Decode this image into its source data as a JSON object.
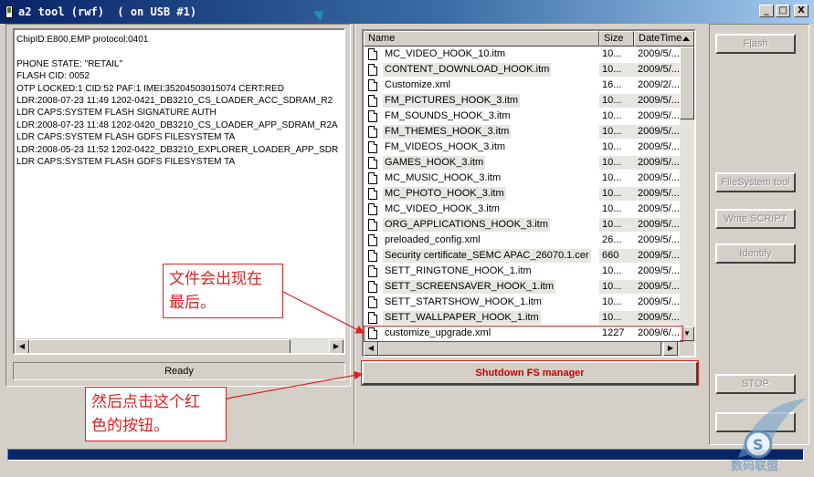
{
  "window": {
    "title": "a2 tool (rwf)  ( on USB #1)",
    "controls": {
      "minimize": "_",
      "maximize": "□",
      "close": "X"
    }
  },
  "log": {
    "lines": [
      "ChipID:E800,EMP protocol:0401",
      "",
      "PHONE STATE: \"RETAIL\"",
      "FLASH CID: 0052",
      "OTP LOCKED:1 CID:52 PAF:1 IMEI:35204503015074 CERT:RED",
      "LDR:2008-07-23 11:49 1202-0421_DB3210_CS_LOADER_ACC_SDRAM_R2",
      "LDR CAPS:SYSTEM FLASH SIGNATURE AUTH",
      "LDR:2008-07-23 11:48 1202-0420_DB3210_CS_LOADER_APP_SDRAM_R2A",
      "LDR CAPS:SYSTEM FLASH GDFS FILESYSTEM TA",
      "LDR:2008-05-23 11:52 1202-0422_DB3210_EXPLORER_LOADER_APP_SDR",
      "LDR CAPS:SYSTEM FLASH GDFS FILESYSTEM TA"
    ],
    "status": "Ready"
  },
  "file_list": {
    "columns": {
      "name": "Name",
      "size": "Size",
      "date": "DateTime"
    },
    "rows": [
      {
        "name": "MC_VIDEO_HOOK_10.itm",
        "size": "10...",
        "date": "2009/5/..."
      },
      {
        "name": "CONTENT_DOWNLOAD_HOOK.itm",
        "size": "10...",
        "date": "2009/5/..."
      },
      {
        "name": "Customize.xml",
        "size": "16...",
        "date": "2009/2/..."
      },
      {
        "name": "FM_PICTURES_HOOK_3.itm",
        "size": "10...",
        "date": "2009/5/..."
      },
      {
        "name": "FM_SOUNDS_HOOK_3.itm",
        "size": "10...",
        "date": "2009/5/..."
      },
      {
        "name": "FM_THEMES_HOOK_3.itm",
        "size": "10...",
        "date": "2009/5/..."
      },
      {
        "name": "FM_VIDEOS_HOOK_3.itm",
        "size": "10...",
        "date": "2009/5/..."
      },
      {
        "name": "GAMES_HOOK_3.itm",
        "size": "10...",
        "date": "2009/5/..."
      },
      {
        "name": "MC_MUSIC_HOOK_3.itm",
        "size": "10...",
        "date": "2009/5/..."
      },
      {
        "name": "MC_PHOTO_HOOK_3.itm",
        "size": "10...",
        "date": "2009/5/..."
      },
      {
        "name": "MC_VIDEO_HOOK_3.itm",
        "size": "10...",
        "date": "2009/5/..."
      },
      {
        "name": "ORG_APPLICATIONS_HOOK_3.itm",
        "size": "10...",
        "date": "2009/5/..."
      },
      {
        "name": "preloaded_config.xml",
        "size": "26...",
        "date": "2009/5/..."
      },
      {
        "name": "Security certificate_SEMC APAC_26070.1.cer",
        "size": "660",
        "date": "2009/5/..."
      },
      {
        "name": "SETT_RINGTONE_HOOK_1.itm",
        "size": "10...",
        "date": "2009/5/..."
      },
      {
        "name": "SETT_SCREENSAVER_HOOK_1.itm",
        "size": "10...",
        "date": "2009/5/..."
      },
      {
        "name": "SETT_STARTSHOW_HOOK_1.itm",
        "size": "10...",
        "date": "2009/5/..."
      },
      {
        "name": "SETT_WALLPAPER_HOOK_1.itm",
        "size": "10...",
        "date": "2009/5/..."
      },
      {
        "name": "customize_upgrade.xml",
        "size": "1227",
        "date": "2009/6/..."
      }
    ]
  },
  "buttons": {
    "shutdown": "Shutdown FS manager",
    "flash": "Flash",
    "filesystem_tool": "FileSystem tool",
    "write_script": "Write SCRIPT",
    "identify": "Identify",
    "stop": "STOP"
  },
  "annotations": {
    "note_top": [
      "文件会出现在",
      "最后。"
    ],
    "note_bottom": [
      "然后点击这个红",
      "色的按钮。"
    ],
    "color": "#e02020"
  },
  "watermark": {
    "text": "数码联盟"
  },
  "icons": {
    "file": "file-icon",
    "app": "app-icon"
  }
}
